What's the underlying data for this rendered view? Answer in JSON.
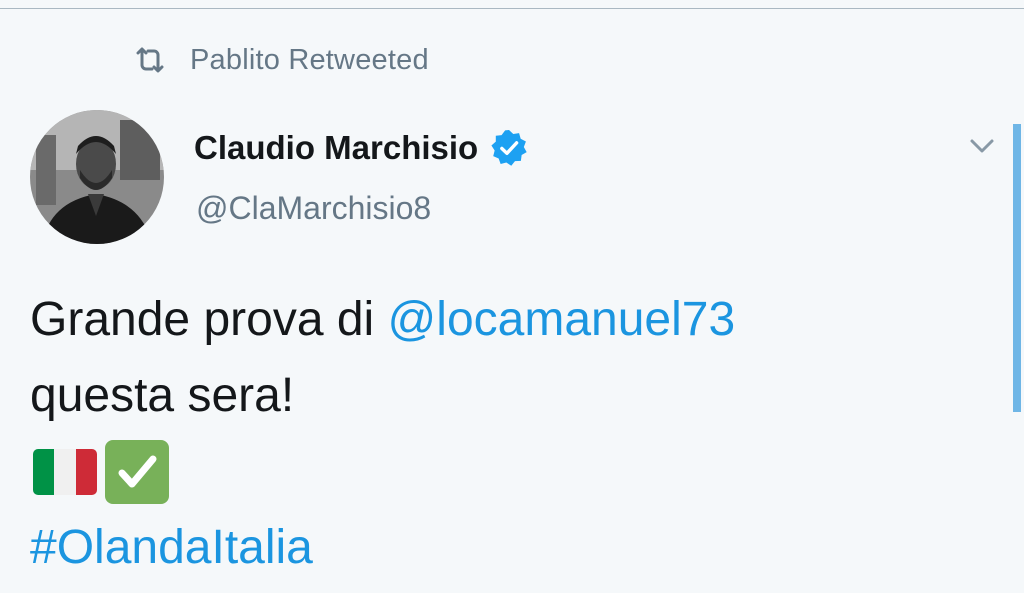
{
  "retweet": {
    "icon": "retweet-icon",
    "text": "Pablito Retweeted"
  },
  "author": {
    "name": "Claudio Marchisio",
    "handle": "@ClaMarchisio8",
    "verified_icon": "verified-badge-icon"
  },
  "tweet": {
    "text_before_mention": "Grande prova di ",
    "mention": "@locamanuel73",
    "text_after_mention": "questa sera!",
    "emojis": [
      "italy-flag-icon",
      "check-mark-button-icon"
    ],
    "hashtag": "#OlandaItalia"
  },
  "colors": {
    "background": "#f5f8fa",
    "link": "#1b95e0",
    "secondary_text": "#657786",
    "primary_text": "#14171a",
    "verified": "#1da1f2"
  }
}
